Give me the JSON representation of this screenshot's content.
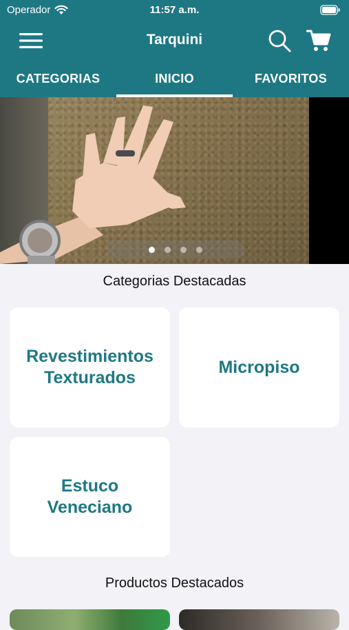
{
  "status_bar": {
    "carrier": "Operador",
    "time": "11:57 a.m."
  },
  "nav": {
    "title": "Tarquini",
    "menu_icon": "hamburger-menu-icon",
    "search_icon": "search-icon",
    "cart_icon": "shopping-cart-icon"
  },
  "tabs": [
    {
      "label": "CATEGORIAS",
      "active": false
    },
    {
      "label": "INICIO",
      "active": true
    },
    {
      "label": "FAVORITOS",
      "active": false
    }
  ],
  "carousel": {
    "page_count": 4,
    "current_page": 1
  },
  "featured_categories": {
    "title": "Categorias Destacadas",
    "items": [
      {
        "line1": "Revestimientos",
        "line2": "Texturados"
      },
      {
        "line1": "Micropiso",
        "line2": ""
      },
      {
        "line1": "Estuco",
        "line2": "Veneciano"
      }
    ]
  },
  "featured_products": {
    "title": "Productos Destacados"
  },
  "colors": {
    "brand": "#1e7884",
    "background": "#f2f2f7",
    "card": "#ffffff"
  }
}
